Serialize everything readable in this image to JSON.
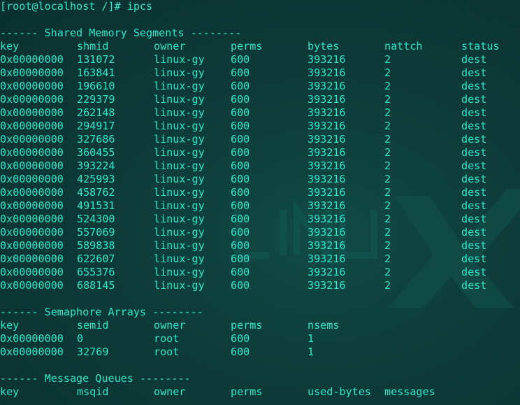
{
  "prompt": "[root@localhost /]# ipcs",
  "shm": {
    "header": "------ Shared Memory Segments --------",
    "columns": [
      "key",
      "shmid",
      "owner",
      "perms",
      "bytes",
      "nattch",
      "status"
    ],
    "rows": [
      [
        "0x00000000",
        "131072",
        "linux-gy",
        "600",
        "393216",
        "2",
        "dest"
      ],
      [
        "0x00000000",
        "163841",
        "linux-gy",
        "600",
        "393216",
        "2",
        "dest"
      ],
      [
        "0x00000000",
        "196610",
        "linux-gy",
        "600",
        "393216",
        "2",
        "dest"
      ],
      [
        "0x00000000",
        "229379",
        "linux-gy",
        "600",
        "393216",
        "2",
        "dest"
      ],
      [
        "0x00000000",
        "262148",
        "linux-gy",
        "600",
        "393216",
        "2",
        "dest"
      ],
      [
        "0x00000000",
        "294917",
        "linux-gy",
        "600",
        "393216",
        "2",
        "dest"
      ],
      [
        "0x00000000",
        "327686",
        "linux-gy",
        "600",
        "393216",
        "2",
        "dest"
      ],
      [
        "0x00000000",
        "360455",
        "linux-gy",
        "600",
        "393216",
        "2",
        "dest"
      ],
      [
        "0x00000000",
        "393224",
        "linux-gy",
        "600",
        "393216",
        "2",
        "dest"
      ],
      [
        "0x00000000",
        "425993",
        "linux-gy",
        "600",
        "393216",
        "2",
        "dest"
      ],
      [
        "0x00000000",
        "458762",
        "linux-gy",
        "600",
        "393216",
        "2",
        "dest"
      ],
      [
        "0x00000000",
        "491531",
        "linux-gy",
        "600",
        "393216",
        "2",
        "dest"
      ],
      [
        "0x00000000",
        "524300",
        "linux-gy",
        "600",
        "393216",
        "2",
        "dest"
      ],
      [
        "0x00000000",
        "557069",
        "linux-gy",
        "600",
        "393216",
        "2",
        "dest"
      ],
      [
        "0x00000000",
        "589838",
        "linux-gy",
        "600",
        "393216",
        "2",
        "dest"
      ],
      [
        "0x00000000",
        "622607",
        "linux-gy",
        "600",
        "393216",
        "2",
        "dest"
      ],
      [
        "0x00000000",
        "655376",
        "linux-gy",
        "600",
        "393216",
        "2",
        "dest"
      ],
      [
        "0x00000000",
        "688145",
        "linux-gy",
        "600",
        "393216",
        "2",
        "dest"
      ]
    ]
  },
  "sem": {
    "header": "------ Semaphore Arrays --------",
    "columns": [
      "key",
      "semid",
      "owner",
      "perms",
      "nsems"
    ],
    "rows": [
      [
        "0x00000000",
        "0",
        "root",
        "600",
        "1"
      ],
      [
        "0x00000000",
        "32769",
        "root",
        "600",
        "1"
      ]
    ]
  },
  "msg": {
    "header": "------ Message Queues --------",
    "columns": [
      "key",
      "msqid",
      "owner",
      "perms",
      "used-bytes",
      "messages"
    ]
  },
  "colors": {
    "text": "#2fe6c8",
    "background": "#0b3433"
  }
}
